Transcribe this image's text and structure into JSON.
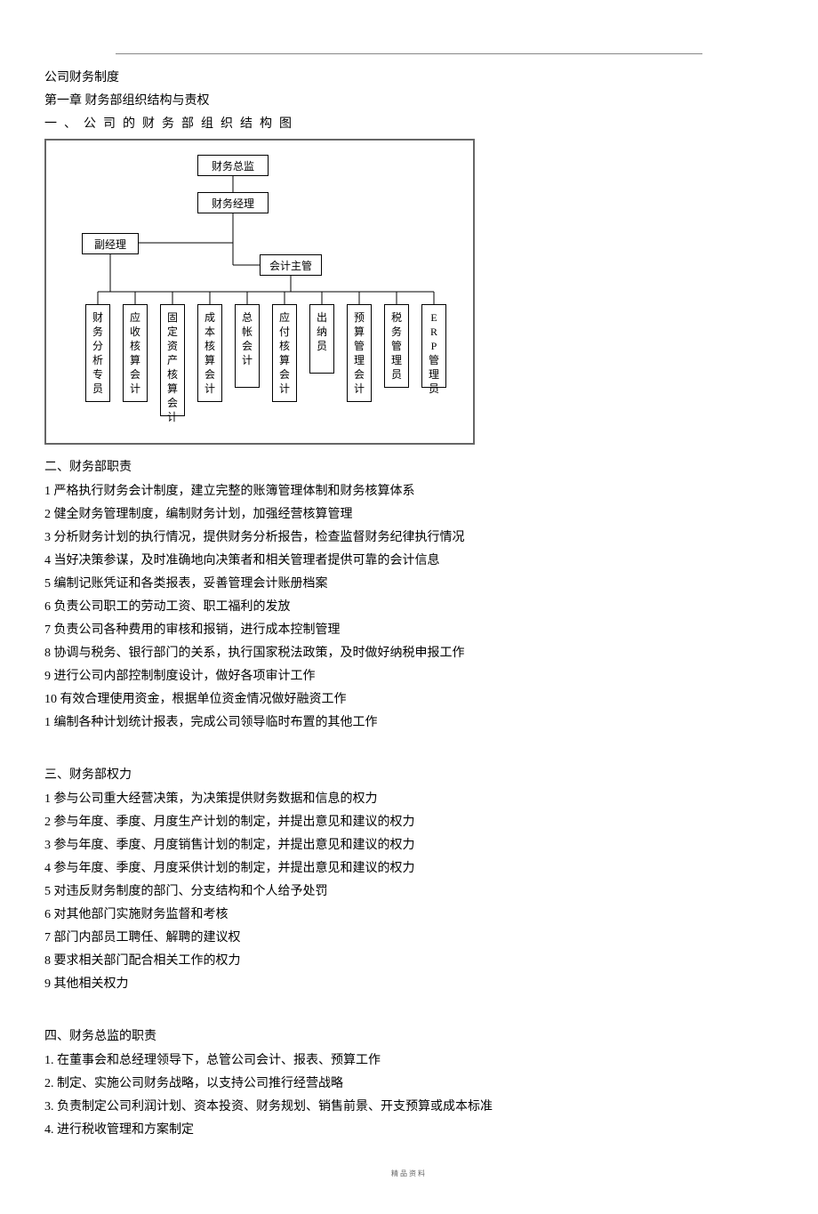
{
  "doc_title": "公司财务制度",
  "chapter_title": "第一章  财务部组织结构与责权",
  "section1_title": "一、公司的财务部组织结构图",
  "org_chart": {
    "top": "财务总监",
    "second": "财务经理",
    "side": "副经理",
    "sub": "会计主管",
    "leaves": [
      "财务分析专员",
      "应收核算会计",
      "固定资产核算会计",
      "成本核算会计",
      "总帐会计",
      "应付核算会计",
      "出纳员",
      "预算管理会计",
      "税务管理员",
      "ERP管理员"
    ]
  },
  "section2_title": "二、财务部职责",
  "section2_items": [
    "1  严格执行财务会计制度，建立完整的账簿管理体制和财务核算体系",
    "2  健全财务管理制度，编制财务计划，加强经营核算管理",
    "3  分析财务计划的执行情况，提供财务分析报告，检查监督财务纪律执行情况",
    "4  当好决策参谋，及时准确地向决策者和相关管理者提供可靠的会计信息",
    "5  编制记账凭证和各类报表，妥善管理会计账册档案",
    "6  负责公司职工的劳动工资、职工福利的发放",
    "7  负责公司各种费用的审核和报销，进行成本控制管理",
    "8  协调与税务、银行部门的关系，执行国家税法政策，及时做好纳税申报工作",
    "9  进行公司内部控制制度设计，做好各项审计工作",
    "10  有效合理使用资金，根据单位资金情况做好融资工作",
    "1 编制各种计划统计报表，完成公司领导临时布置的其他工作"
  ],
  "section3_title": "三、财务部权力",
  "section3_items": [
    "1  参与公司重大经营决策，为决策提供财务数据和信息的权力",
    "2  参与年度、季度、月度生产计划的制定，并提出意见和建议的权力",
    "3  参与年度、季度、月度销售计划的制定，并提出意见和建议的权力",
    "4  参与年度、季度、月度采供计划的制定，并提出意见和建议的权力",
    "5  对违反财务制度的部门、分支结构和个人给予处罚",
    "6  对其他部门实施财务监督和考核",
    " 7  部门内部员工聘任、解聘的建议权",
    "8  要求相关部门配合相关工作的权力",
    "9  其他相关权力"
  ],
  "section4_title": "四、财务总监的职责",
  "section4_items": [
    "1.    在董事会和总经理领导下，总管公司会计、报表、预算工作",
    "2.    制定、实施公司财务战略，以支持公司推行经营战略",
    "3.    负责制定公司利润计划、资本投资、财务规划、销售前景、开支预算或成本标准",
    "4.    进行税收管理和方案制定"
  ],
  "footer": "精品资料"
}
